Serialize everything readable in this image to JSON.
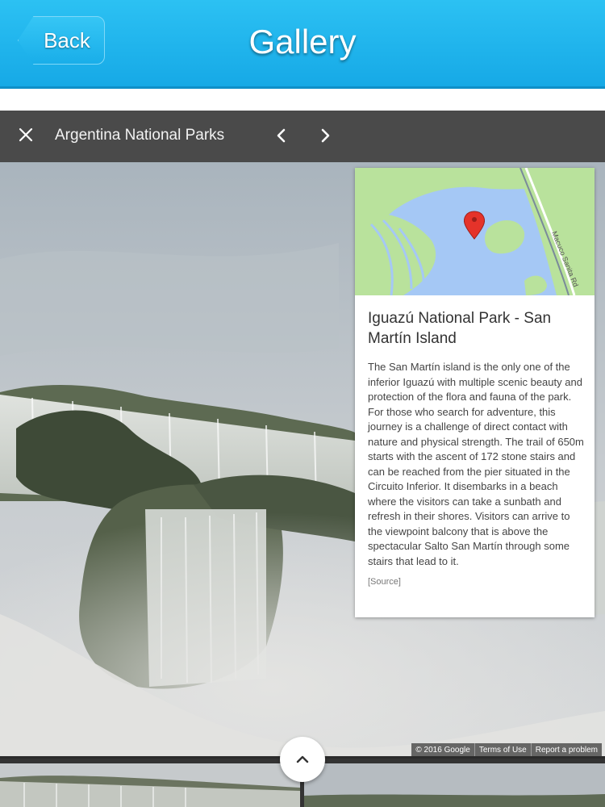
{
  "header": {
    "back_label": "Back",
    "title": "Gallery"
  },
  "gallery_bar": {
    "title": "Argentina National Parks",
    "close_icon": "close-icon",
    "prev_icon": "chevron-left-icon",
    "next_icon": "chevron-right-icon"
  },
  "info_card": {
    "map_road_label": "Macuco Sanita Rd",
    "title": "Iguazú National Park - San Martín Island",
    "description": "The San Martín island is the only one of the inferior Iguazú with multiple scenic beauty and protection of the flora and fauna of the park. For those who search for adventure, this journey is a challenge of direct contact with nature and physical strength. The trail of 650m starts with the ascent of 172 stone stairs and can be reached from the pier situated in the Circuito Inferior. It disembarks in a beach where the visitors can take a sunbath and refresh in their shores. Visitors can arrive to the viewpoint balcony that is above the spectacular Salto San Martín through some stairs that lead to it.",
    "source_label": "[Source]"
  },
  "attribution": {
    "copyright": "© 2016 Google",
    "terms": "Terms of Use",
    "report": "Report a problem"
  },
  "filmstrip": {
    "expand_icon": "chevron-up-icon"
  },
  "colors": {
    "header_blue": "#1fb3ec",
    "toolbar_gray": "#4a4a4a",
    "map_water": "#a5c8f5",
    "map_land": "#b9e29c",
    "map_pin": "#e5332a"
  }
}
